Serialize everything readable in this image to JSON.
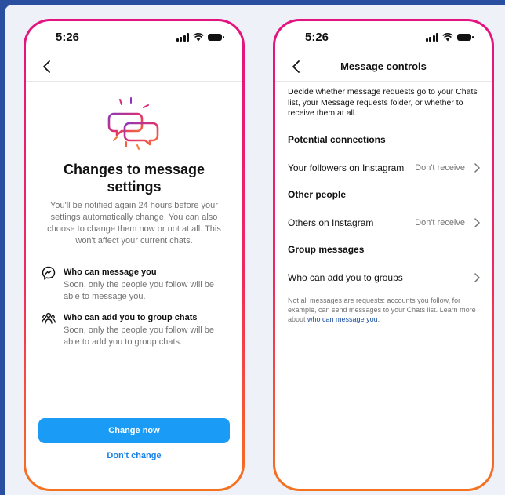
{
  "left": {
    "time": "5:26",
    "heading": "Changes to message settings",
    "description": "You'll be notified again 24 hours before your settings automatically change. You can also choose to change them now or not at all. This won't affect your current chats.",
    "features": [
      {
        "icon": "messenger-icon",
        "title": "Who can message you",
        "desc": "Soon, only the people you follow will be able to message you."
      },
      {
        "icon": "group-icon",
        "title": "Who can add you to group chats",
        "desc": "Soon, only the people you follow will be able to add you to group chats."
      }
    ],
    "primary_button": "Change now",
    "secondary_button": "Don't change",
    "accent": "#1a9bf5"
  },
  "right": {
    "time": "5:26",
    "title": "Message controls",
    "intro": "Decide whether message requests go to your Chats list, your Message requests folder, or whether to receive them at all.",
    "sections": [
      {
        "heading": "Potential connections",
        "row_label": "Your followers on Instagram",
        "row_value": "Don't receive"
      },
      {
        "heading": "Other people",
        "row_label": "Others on Instagram",
        "row_value": "Don't receive"
      },
      {
        "heading": "Group messages",
        "row_label": "Who can add you to groups",
        "row_value": ""
      }
    ],
    "footer_text": "Not all messages are requests: accounts you follow, for example, can send messages to your Chats list. Learn more about ",
    "footer_link": "who can message you",
    "footer_end": "."
  }
}
